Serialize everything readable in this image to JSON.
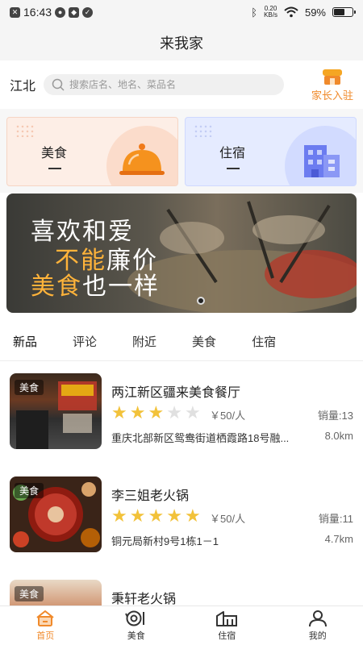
{
  "status_bar": {
    "time": "16:43",
    "net_speed_value": "0.20",
    "net_speed_unit": "KB/s",
    "battery": "59%",
    "battery_level": 0.59
  },
  "header": {
    "title": "来我家"
  },
  "search": {
    "city": "江北",
    "placeholder": "搜索店名、地名、菜品名",
    "host_label": "家长入驻"
  },
  "categories": [
    {
      "label": "美食",
      "icon": "food-cover-icon"
    },
    {
      "label": "住宿",
      "icon": "building-icon"
    }
  ],
  "banner": {
    "line1": "喜欢和爱",
    "line2_a": "不能",
    "line2_b": "廉价",
    "line3_a": "美食",
    "line3_b": "也一样",
    "colors": {
      "highlight": "#ffb33a",
      "text": "#ffffff"
    }
  },
  "tabs": [
    {
      "label": "新品",
      "active": true
    },
    {
      "label": "评论",
      "active": false
    },
    {
      "label": "附近",
      "active": false
    },
    {
      "label": "美食",
      "active": false
    },
    {
      "label": "住宿",
      "active": false
    }
  ],
  "listings": [
    {
      "tag": "美食",
      "name": "两江新区疆来美食餐厅",
      "rating": 3,
      "price": "￥50/人",
      "sales": "销量:13",
      "address": "重庆北部新区鸳鸯街道栖霞路18号融...",
      "distance": "8.0km"
    },
    {
      "tag": "美食",
      "name": "李三姐老火锅",
      "rating": 5,
      "price": "￥50/人",
      "sales": "销量:11",
      "address": "铜元局新村9号1栋1－1",
      "distance": "4.7km"
    },
    {
      "tag": "美食",
      "name": "秉轩老火锅"
    }
  ],
  "bottom_nav": [
    {
      "label": "首页",
      "icon": "home-icon",
      "active": true
    },
    {
      "label": "美食",
      "icon": "food-icon",
      "active": false
    },
    {
      "label": "住宿",
      "icon": "building-icon",
      "active": false
    },
    {
      "label": "我的",
      "icon": "user-icon",
      "active": false
    }
  ],
  "colors": {
    "accent": "#f08a2b",
    "star": "#f2c23a"
  }
}
